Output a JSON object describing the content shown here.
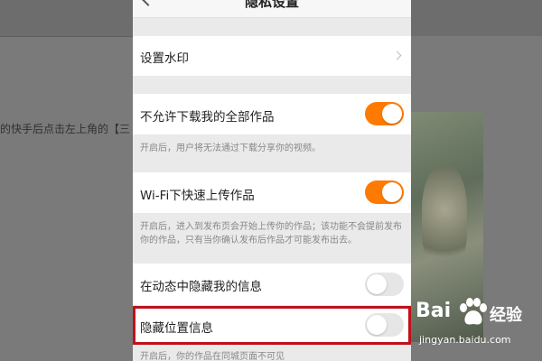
{
  "background_article": {
    "text": "的快手后点击左上角的【三"
  },
  "nav": {
    "title": "隐私设置"
  },
  "settings": {
    "watermark": {
      "label": "设置水印"
    },
    "no_download": {
      "label": "不允许下载我的全部作品",
      "state": "on",
      "hint": "开启后，用户将无法通过下载分享你的视频。"
    },
    "wifi_upload": {
      "label": "Wi-Fi下快速上传作品",
      "state": "on",
      "hint": "开启后，进入到发布页会开始上传你的作品；该功能不会提前发布你的作品，只有当你确认发布后作品才可能发布出去。"
    },
    "hide_in_feed": {
      "label": "在动态中隐藏我的信息",
      "state": "off"
    },
    "hide_location": {
      "label": "隐藏位置信息",
      "state": "off",
      "hint": "开启后，你的作品在同城页面不可见"
    }
  },
  "colors": {
    "toggle_on": "#ff7a00",
    "highlight": "#c0101a"
  },
  "watermark": {
    "logo_text": "Bai",
    "logo_text2": "经验",
    "url": "jingyan.baidu.com"
  }
}
